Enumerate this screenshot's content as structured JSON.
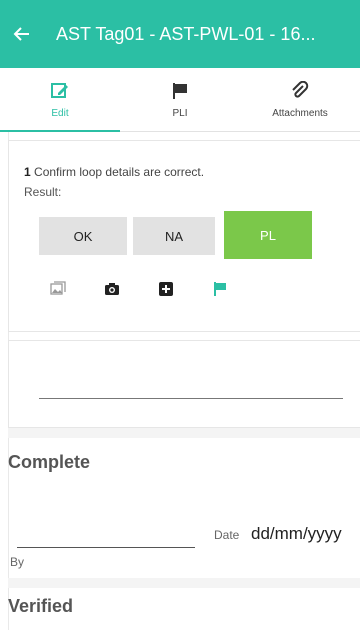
{
  "appbar": {
    "title": "AST Tag01 - AST-PWL-01 - 16...",
    "back_icon": "back-arrow-icon"
  },
  "tabs": [
    {
      "label": "Edit",
      "icon": "edit-icon",
      "active": true
    },
    {
      "label": "PLI",
      "icon": "flag-icon",
      "active": false
    },
    {
      "label": "Attachments",
      "icon": "paperclip-icon",
      "active": false
    }
  ],
  "item": {
    "number": "1",
    "question": "Confirm loop details are correct.",
    "result_label": "Result:",
    "buttons": {
      "ok": "OK",
      "na": "NA",
      "pl": "PL"
    },
    "selected": "PL",
    "action_icons": [
      "gallery-icon",
      "camera-icon",
      "add-icon",
      "flag-icon"
    ]
  },
  "complete": {
    "title": "Complete",
    "by_label": "By",
    "date_label": "Date",
    "date_placeholder": "dd/mm/yyyy"
  },
  "verified": {
    "title": "Verified"
  },
  "colors": {
    "primary": "#2bbfa4",
    "selected_result": "#7bc84a",
    "button_default": "#e2e2e2"
  }
}
